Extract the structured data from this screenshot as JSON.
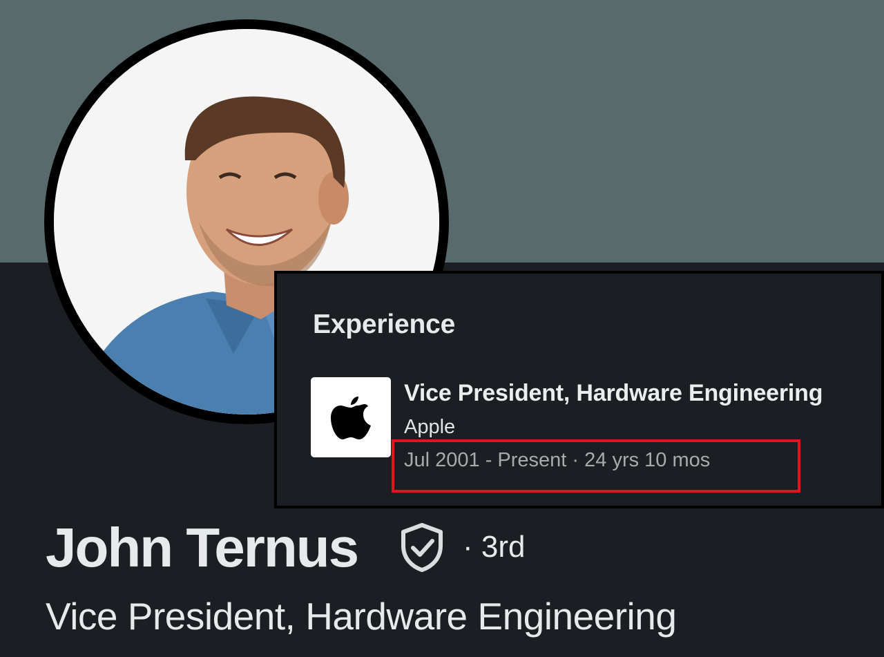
{
  "colors": {
    "banner": "#596a6d",
    "card_background": "#1b1f23",
    "highlight_border": "#e0161d",
    "primary_text": "#e8e9ea",
    "secondary_text": "#a8aaab"
  },
  "profile": {
    "name": "John Ternus",
    "verified_icon": "shield-check-icon",
    "connection_degree": "· 3rd",
    "headline": "Vice President, Hardware Engineering"
  },
  "experience": {
    "heading": "Experience",
    "items": [
      {
        "logo_icon": "apple-logo-icon",
        "title": "Vice President, Hardware Engineering",
        "company": "Apple",
        "duration": "Jul 2001 - Present · 24 yrs 10 mos"
      }
    ]
  }
}
